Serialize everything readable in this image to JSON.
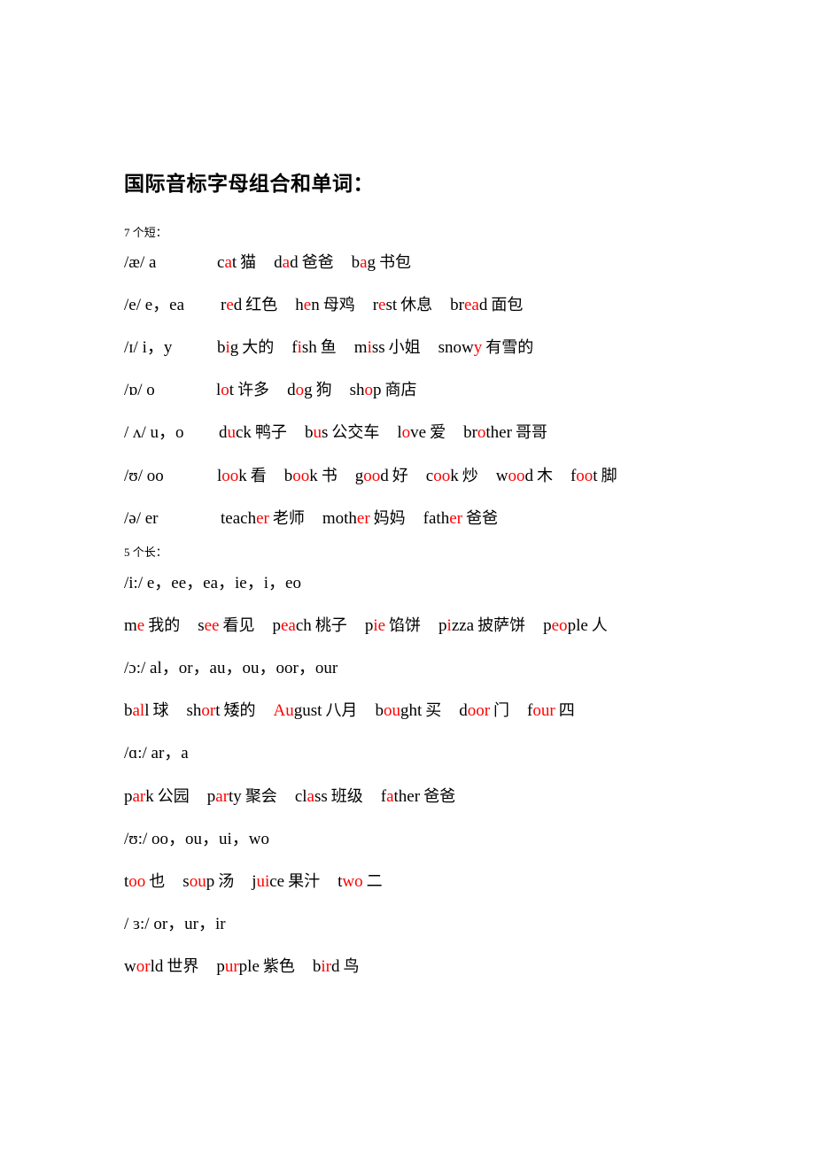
{
  "title": "国际音标字母组合和单词：",
  "highlight_color": "#ff0000",
  "short_label": "7 个短：",
  "long_label": "5 个长：",
  "short_vowels": [
    {
      "symbol": "/æ/ a",
      "words": [
        {
          "parts": [
            [
              "c",
              0
            ],
            [
              "a",
              1
            ],
            [
              "t",
              0
            ]
          ],
          "cn": "猫"
        },
        {
          "parts": [
            [
              "d",
              0
            ],
            [
              "a",
              1
            ],
            [
              "d",
              0
            ]
          ],
          "cn": "爸爸"
        },
        {
          "parts": [
            [
              "b",
              0
            ],
            [
              "a",
              1
            ],
            [
              "g",
              0
            ]
          ],
          "cn": "书包"
        }
      ]
    },
    {
      "symbol": "/e/ e，ea",
      "words": [
        {
          "parts": [
            [
              "r",
              0
            ],
            [
              "e",
              1
            ],
            [
              "d",
              0
            ]
          ],
          "cn": "红色"
        },
        {
          "parts": [
            [
              "h",
              0
            ],
            [
              "e",
              1
            ],
            [
              "n",
              0
            ]
          ],
          "cn": "母鸡"
        },
        {
          "parts": [
            [
              "r",
              0
            ],
            [
              "e",
              1
            ],
            [
              "st",
              0
            ]
          ],
          "cn": "休息"
        },
        {
          "parts": [
            [
              "br",
              0
            ],
            [
              "ea",
              1
            ],
            [
              "d",
              0
            ]
          ],
          "cn": "面包"
        }
      ]
    },
    {
      "symbol": "/ɪ/ i，y",
      "words": [
        {
          "parts": [
            [
              "b",
              0
            ],
            [
              "i",
              1
            ],
            [
              "g",
              0
            ]
          ],
          "cn": "大的"
        },
        {
          "parts": [
            [
              "f",
              0
            ],
            [
              "i",
              1
            ],
            [
              "sh",
              0
            ]
          ],
          "cn": "鱼"
        },
        {
          "parts": [
            [
              "m",
              0
            ],
            [
              "i",
              1
            ],
            [
              "ss",
              0
            ]
          ],
          "cn": "小姐"
        },
        {
          "parts": [
            [
              "snow",
              0
            ],
            [
              "y",
              1
            ]
          ],
          "cn": "有雪的"
        }
      ]
    },
    {
      "symbol": "/ɒ/ o",
      "words": [
        {
          "parts": [
            [
              "l",
              0
            ],
            [
              "o",
              1
            ],
            [
              "t",
              0
            ]
          ],
          "cn": "许多"
        },
        {
          "parts": [
            [
              "d",
              0
            ],
            [
              "o",
              1
            ],
            [
              "g",
              0
            ]
          ],
          "cn": "狗"
        },
        {
          "parts": [
            [
              "sh",
              0
            ],
            [
              "o",
              1
            ],
            [
              "p",
              0
            ]
          ],
          "cn": "商店"
        }
      ]
    },
    {
      "symbol": "/ ʌ/ u，o",
      "words": [
        {
          "parts": [
            [
              "d",
              0
            ],
            [
              "u",
              1
            ],
            [
              "ck",
              0
            ]
          ],
          "cn": "鸭子"
        },
        {
          "parts": [
            [
              "b",
              0
            ],
            [
              "u",
              1
            ],
            [
              "s",
              0
            ]
          ],
          "cn": "公交车"
        },
        {
          "parts": [
            [
              "l",
              0
            ],
            [
              "o",
              1
            ],
            [
              "ve",
              0
            ]
          ],
          "cn": "爱"
        },
        {
          "parts": [
            [
              "br",
              0
            ],
            [
              "o",
              1
            ],
            [
              "ther",
              0
            ]
          ],
          "cn": "哥哥"
        }
      ]
    },
    {
      "symbol": "/ʊ/ oo",
      "words": [
        {
          "parts": [
            [
              "l",
              0
            ],
            [
              "oo",
              1
            ],
            [
              "k",
              0
            ]
          ],
          "cn": "看"
        },
        {
          "parts": [
            [
              "b",
              0
            ],
            [
              "oo",
              1
            ],
            [
              "k",
              0
            ]
          ],
          "cn": "书"
        },
        {
          "parts": [
            [
              "g",
              0
            ],
            [
              "oo",
              1
            ],
            [
              "d",
              0
            ]
          ],
          "cn": "好"
        },
        {
          "parts": [
            [
              "c",
              0
            ],
            [
              "oo",
              1
            ],
            [
              "k",
              0
            ]
          ],
          "cn": "炒"
        },
        {
          "parts": [
            [
              "w",
              0
            ],
            [
              "oo",
              1
            ],
            [
              "d",
              0
            ]
          ],
          "cn": "木"
        },
        {
          "parts": [
            [
              "f",
              0
            ],
            [
              "oo",
              1
            ],
            [
              "t",
              0
            ]
          ],
          "cn": "脚"
        }
      ]
    },
    {
      "symbol": "/ə/ er",
      "words": [
        {
          "parts": [
            [
              "teach",
              0
            ],
            [
              "er",
              1
            ]
          ],
          "cn": "老师"
        },
        {
          "parts": [
            [
              "moth",
              0
            ],
            [
              "er",
              1
            ]
          ],
          "cn": "妈妈"
        },
        {
          "parts": [
            [
              "fath",
              0
            ],
            [
              "er",
              1
            ]
          ],
          "cn": "爸爸"
        }
      ]
    }
  ],
  "long_vowels": [
    {
      "symbol": "/i:/ e，ee，ea，ie，i，eo",
      "words": [
        {
          "parts": [
            [
              "m",
              0
            ],
            [
              "e",
              1
            ]
          ],
          "cn": "我的"
        },
        {
          "parts": [
            [
              "s",
              0
            ],
            [
              "ee",
              1
            ]
          ],
          "cn": "看见"
        },
        {
          "parts": [
            [
              "p",
              0
            ],
            [
              "ea",
              1
            ],
            [
              "ch",
              0
            ]
          ],
          "cn": "桃子"
        },
        {
          "parts": [
            [
              "p",
              0
            ],
            [
              "ie",
              1
            ]
          ],
          "cn": "馅饼"
        },
        {
          "parts": [
            [
              "p",
              0
            ],
            [
              "i",
              1
            ],
            [
              "zza",
              0
            ]
          ],
          "cn": "披萨饼"
        },
        {
          "parts": [
            [
              "p",
              0
            ],
            [
              "eo",
              1
            ],
            [
              "ple",
              0
            ]
          ],
          "cn": "人"
        }
      ]
    },
    {
      "symbol": "/ɔ:/ al，or，au，ou，oor，our",
      "words": [
        {
          "parts": [
            [
              "b",
              0
            ],
            [
              "al",
              1
            ],
            [
              "l",
              0
            ]
          ],
          "cn": "球"
        },
        {
          "parts": [
            [
              "sh",
              0
            ],
            [
              "or",
              1
            ],
            [
              "t",
              0
            ]
          ],
          "cn": "矮的"
        },
        {
          "parts": [
            [
              "Au",
              1
            ],
            [
              "gust",
              0
            ]
          ],
          "cn": "八月"
        },
        {
          "parts": [
            [
              "b",
              0
            ],
            [
              "ou",
              1
            ],
            [
              "ght",
              0
            ]
          ],
          "cn": "买"
        },
        {
          "parts": [
            [
              "d",
              0
            ],
            [
              "oor",
              1
            ]
          ],
          "cn": "门"
        },
        {
          "parts": [
            [
              "f",
              0
            ],
            [
              "our",
              1
            ]
          ],
          "cn": "四"
        }
      ]
    },
    {
      "symbol": "/ɑ:/ ar，a",
      "words": [
        {
          "parts": [
            [
              "p",
              0
            ],
            [
              "ar",
              1
            ],
            [
              "k",
              0
            ]
          ],
          "cn": "公园"
        },
        {
          "parts": [
            [
              "p",
              0
            ],
            [
              "ar",
              1
            ],
            [
              "ty",
              0
            ]
          ],
          "cn": "聚会"
        },
        {
          "parts": [
            [
              "cl",
              0
            ],
            [
              "a",
              1
            ],
            [
              "ss",
              0
            ]
          ],
          "cn": "班级"
        },
        {
          "parts": [
            [
              "f",
              0
            ],
            [
              "a",
              1
            ],
            [
              "ther",
              0
            ]
          ],
          "cn": "爸爸"
        }
      ]
    },
    {
      "symbol": "/ʊ:/ oo，ou，ui，wo",
      "words": [
        {
          "parts": [
            [
              "t",
              0
            ],
            [
              "oo",
              1
            ]
          ],
          "cn": "也"
        },
        {
          "parts": [
            [
              "s",
              0
            ],
            [
              "ou",
              1
            ],
            [
              "p",
              0
            ]
          ],
          "cn": "汤"
        },
        {
          "parts": [
            [
              "j",
              0
            ],
            [
              "ui",
              1
            ],
            [
              "ce",
              0
            ]
          ],
          "cn": "果汁"
        },
        {
          "parts": [
            [
              "t",
              0
            ],
            [
              "wo",
              1
            ]
          ],
          "cn": "二"
        }
      ]
    },
    {
      "symbol": "/ ɜ:/ or，ur，ir",
      "words": [
        {
          "parts": [
            [
              "w",
              0
            ],
            [
              "or",
              1
            ],
            [
              "ld",
              0
            ]
          ],
          "cn": "世界"
        },
        {
          "parts": [
            [
              "p",
              0
            ],
            [
              "ur",
              1
            ],
            [
              "ple",
              0
            ]
          ],
          "cn": "紫色"
        },
        {
          "parts": [
            [
              "b",
              0
            ],
            [
              "ir",
              1
            ],
            [
              "d",
              0
            ]
          ],
          "cn": "鸟"
        }
      ]
    }
  ]
}
